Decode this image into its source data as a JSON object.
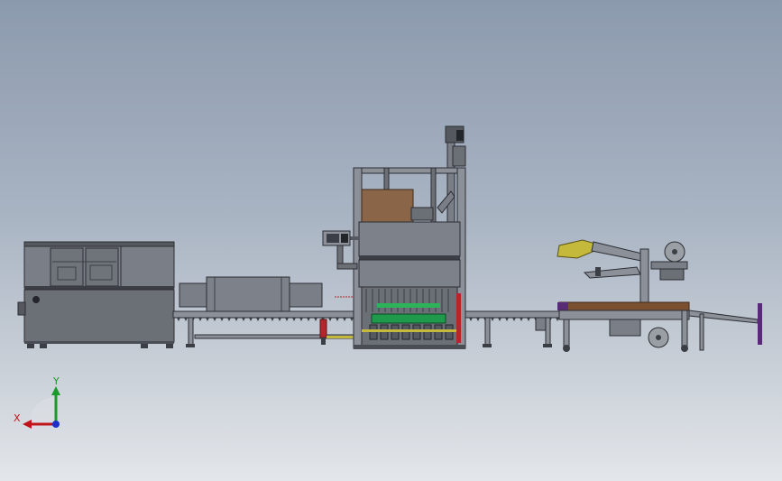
{
  "viewport": {
    "background_top": "#8c9aae",
    "background_bottom": "#e3e6ea"
  },
  "triad": {
    "x_label": "X",
    "y_label": "Y",
    "x_color": "#c0141b",
    "y_color": "#1a9a2a",
    "z_color": "#1a2fd0"
  },
  "machines": [
    {
      "name": "case-erector",
      "icon": "cabinet-icon"
    },
    {
      "name": "infeed-conveyor",
      "icon": "roller-conveyor-icon"
    },
    {
      "name": "case-packer",
      "icon": "packer-frame-icon"
    },
    {
      "name": "outfeed-conveyor",
      "icon": "roller-conveyor-icon"
    },
    {
      "name": "case-sealer",
      "icon": "tape-sealer-icon"
    }
  ],
  "colors": {
    "frame": "#6b6f76",
    "panel": "#7a7e86",
    "dark": "#3b3e44",
    "cardboard": "#8a6548",
    "accent_green": "#1f9a4c",
    "accent_red": "#b3262b",
    "accent_yellow": "#c4b93a",
    "accent_purple": "#5a2a7a",
    "belt_brown": "#7a5030"
  }
}
